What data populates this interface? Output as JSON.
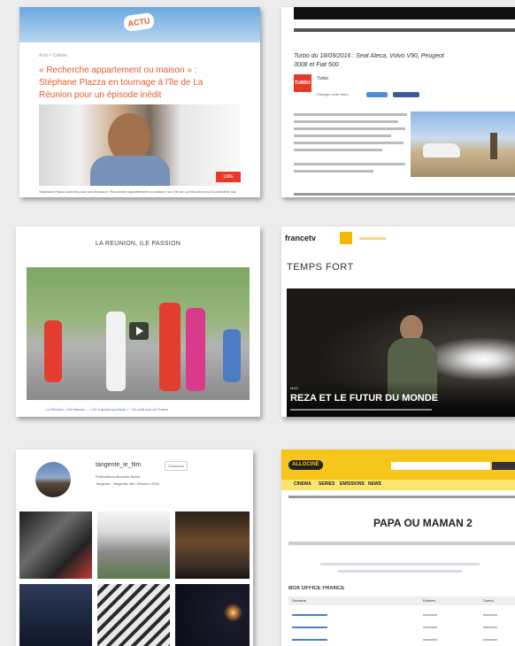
{
  "card1": {
    "badge": "ACTU",
    "breadcrumb": "Actu > Culture",
    "headline_line1": "« Recherche appartement ou maison » :",
    "headline_line2": "Stéphane Plazza en tournage à l'île de La",
    "headline_line3": "Réunion pour un épisode inédit",
    "tag": "LIRE",
    "body": "Stéphane Plaza tournera pour son émission \"Recherche appartement ou maison\" sur l'île de La Réunion pour la première fois"
  },
  "card2": {
    "title_line1": "Turbo du 18/09/2016 : Seat Ateca, Volvo V90, Peugeot",
    "title_line2": "3008 et Fiat 500",
    "logo": "TURBO",
    "source": "Turbo",
    "share_label": "Partager cette vidéo"
  },
  "card3": {
    "title": "LA RÉUNION, ÎLE PASSION",
    "caption": "La Réunion, c'île intense — « Île à grand spectacle » · Un petit coin de France"
  },
  "card4": {
    "brand": "francetv",
    "title": "TEMPS FORT",
    "overlay_kicker": "MAG",
    "overlay_title": "REZA ET LE FUTUR DU MONDE"
  },
  "card5": {
    "username": "tangente_le_film",
    "follow": "S'abonner",
    "stats": "Publications   Abonnés   Suivis",
    "bio": "Tangente : Tangente, film. Réunion 2016"
  },
  "card6": {
    "logo": "ALLOCINÉ",
    "nav": [
      "CINÉMA",
      "SÉRIES",
      "ÉMISSIONS",
      "NEWS"
    ],
    "title": "PAPA OU MAMAN 2",
    "section": "BOX OFFICE FRANCE",
    "columns": [
      "Semaine",
      "Entrées",
      "Cumul"
    ]
  },
  "colors": {
    "accent_orange": "#e55b2d",
    "allocine_yellow": "#f6c61b",
    "france_tv_yellow": "#f5b800"
  }
}
